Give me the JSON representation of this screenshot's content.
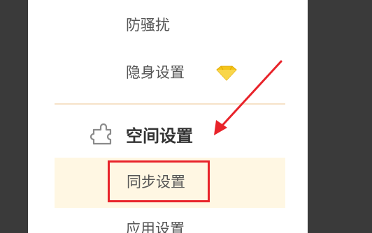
{
  "menu": {
    "items": [
      {
        "label": "防骚扰"
      },
      {
        "label": "隐身设置",
        "badge_icon": "diamond-icon"
      }
    ],
    "section": {
      "title": "空间设置",
      "icon": "puzzle-icon"
    },
    "sub_items": [
      {
        "label": "同步设置",
        "selected": true
      },
      {
        "label": "应用设置"
      }
    ]
  },
  "colors": {
    "background": "#3a3a3a",
    "panel": "#ffffff",
    "highlight_row": "#fff7e3",
    "annotation_red": "#e8232a",
    "diamond": "#f5c518"
  }
}
